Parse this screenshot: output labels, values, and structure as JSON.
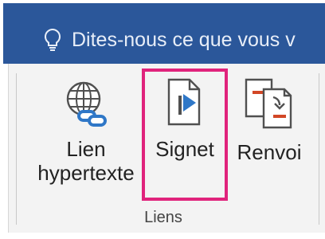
{
  "tell_me": {
    "text": "Dites-nous ce que vous v"
  },
  "buttons": {
    "hyperlink": {
      "line1": "Lien",
      "line2": "hypertexte",
      "icon": "globe-link-icon"
    },
    "bookmark": {
      "label": "Signet",
      "icon": "bookmark-flag-icon"
    },
    "crossref": {
      "label": "Renvoi",
      "icon": "cross-reference-icon"
    }
  },
  "group": {
    "label": "Liens"
  },
  "colors": {
    "titlebar": "#2b579a",
    "highlight": "#e0237c",
    "accent_blue": "#2f77c7",
    "accent_red": "#d24726"
  }
}
